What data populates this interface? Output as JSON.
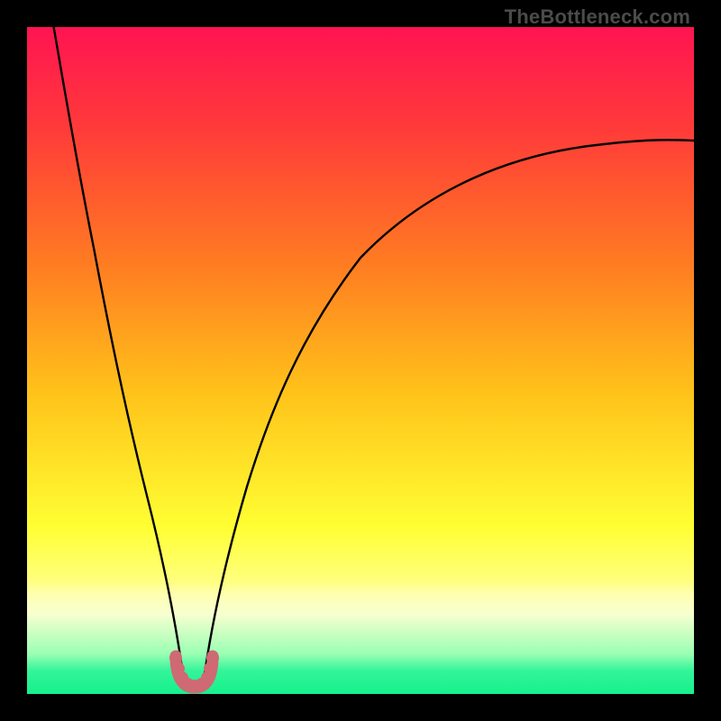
{
  "watermark": "TheBottleneck.com",
  "colors": {
    "frame": "#000000",
    "curve": "#000000",
    "marker": "#cf6973",
    "gradient_stops": [
      {
        "offset": 0.0,
        "color": "#ff1452"
      },
      {
        "offset": 0.15,
        "color": "#ff3a3a"
      },
      {
        "offset": 0.35,
        "color": "#ff7a22"
      },
      {
        "offset": 0.55,
        "color": "#ffc31a"
      },
      {
        "offset": 0.75,
        "color": "#ffff33"
      },
      {
        "offset": 0.83,
        "color": "#ffff7d"
      },
      {
        "offset": 0.85,
        "color": "#ffffb0"
      },
      {
        "offset": 0.88,
        "color": "#f7ffd0"
      },
      {
        "offset": 0.94,
        "color": "#9affb3"
      },
      {
        "offset": 0.965,
        "color": "#34f49a"
      },
      {
        "offset": 1.0,
        "color": "#15f18c"
      }
    ]
  },
  "chart_data": {
    "type": "line",
    "title": "",
    "xlabel": "",
    "ylabel": "",
    "xlim": [
      0,
      100
    ],
    "ylim": [
      0,
      100
    ],
    "grid": false,
    "series": [
      {
        "name": "bottleneck-left",
        "x": [
          4,
          6,
          8,
          10,
          12,
          14,
          16,
          18,
          20,
          22,
          23.5
        ],
        "y": [
          100,
          90,
          79,
          68,
          57,
          45.5,
          34.5,
          24,
          14,
          6,
          2
        ]
      },
      {
        "name": "bottleneck-right",
        "x": [
          26.5,
          28,
          30,
          33,
          36,
          40,
          45,
          50,
          56,
          63,
          71,
          80,
          90,
          100
        ],
        "y": [
          2,
          6,
          14,
          25,
          34,
          44,
          53,
          59,
          65,
          70,
          74,
          77.5,
          80.5,
          83
        ]
      }
    ],
    "marker_region": {
      "x_range": [
        22.2,
        27.6
      ],
      "y_range": [
        0,
        5
      ],
      "shape": "U"
    },
    "gradient_description": "Vertical spectrum: red (top) → orange → yellow → pale → green (bottom), representing bottleneck severity from high to none."
  }
}
